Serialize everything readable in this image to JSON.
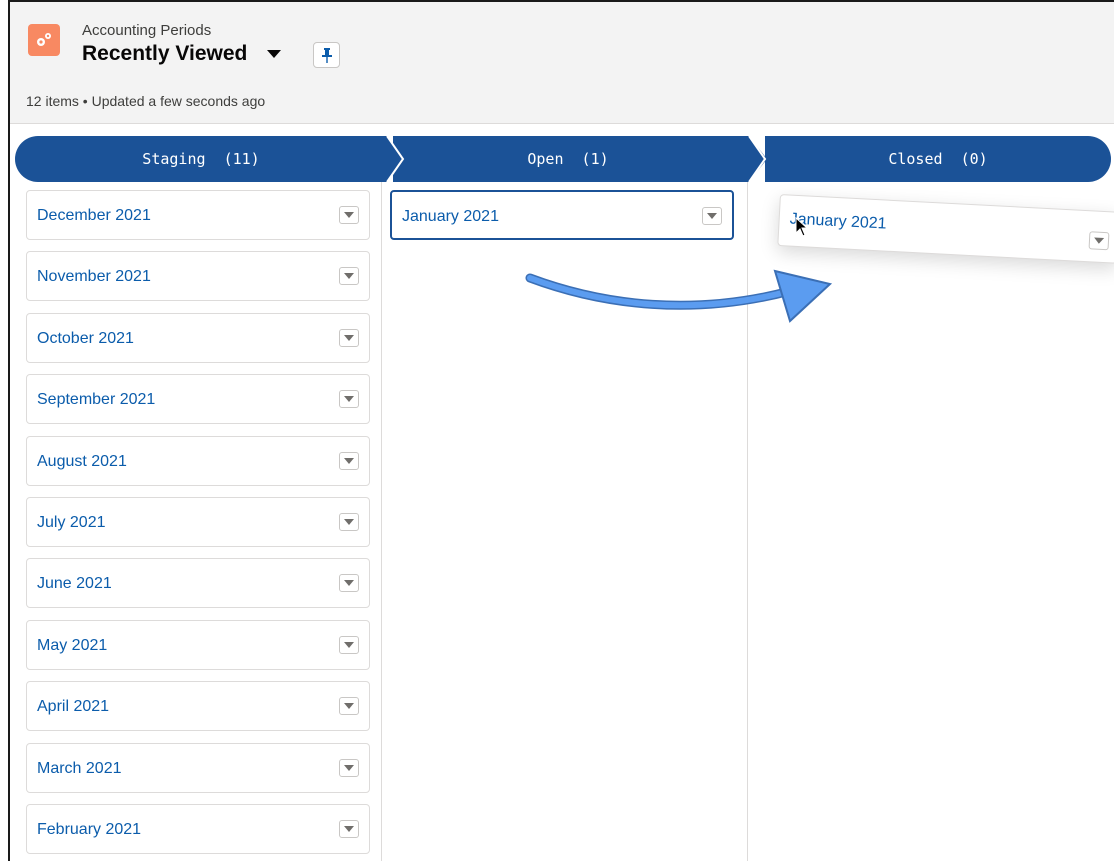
{
  "header": {
    "object_name": "Accounting Periods",
    "list_view_name": "Recently Viewed",
    "meta": "12 items • Updated a few seconds ago"
  },
  "stages": [
    {
      "label": "Staging  (11)"
    },
    {
      "label": "Open  (1)"
    },
    {
      "label": "Closed  (0)"
    }
  ],
  "staging_cards": [
    {
      "title": "December 2021"
    },
    {
      "title": "November 2021"
    },
    {
      "title": "October 2021"
    },
    {
      "title": "September 2021"
    },
    {
      "title": "August 2021"
    },
    {
      "title": "July 2021"
    },
    {
      "title": "June 2021"
    },
    {
      "title": "May 2021"
    },
    {
      "title": "April 2021"
    },
    {
      "title": "March 2021"
    },
    {
      "title": "February 2021"
    }
  ],
  "open_cards": [
    {
      "title": "January 2021"
    }
  ],
  "dragging_card": {
    "title": "January 2021"
  },
  "colors": {
    "stage_bar": "#1b5297",
    "link": "#0b5cab",
    "app_icon": "#f88962",
    "drag_arrow": "#5b9cf0"
  }
}
